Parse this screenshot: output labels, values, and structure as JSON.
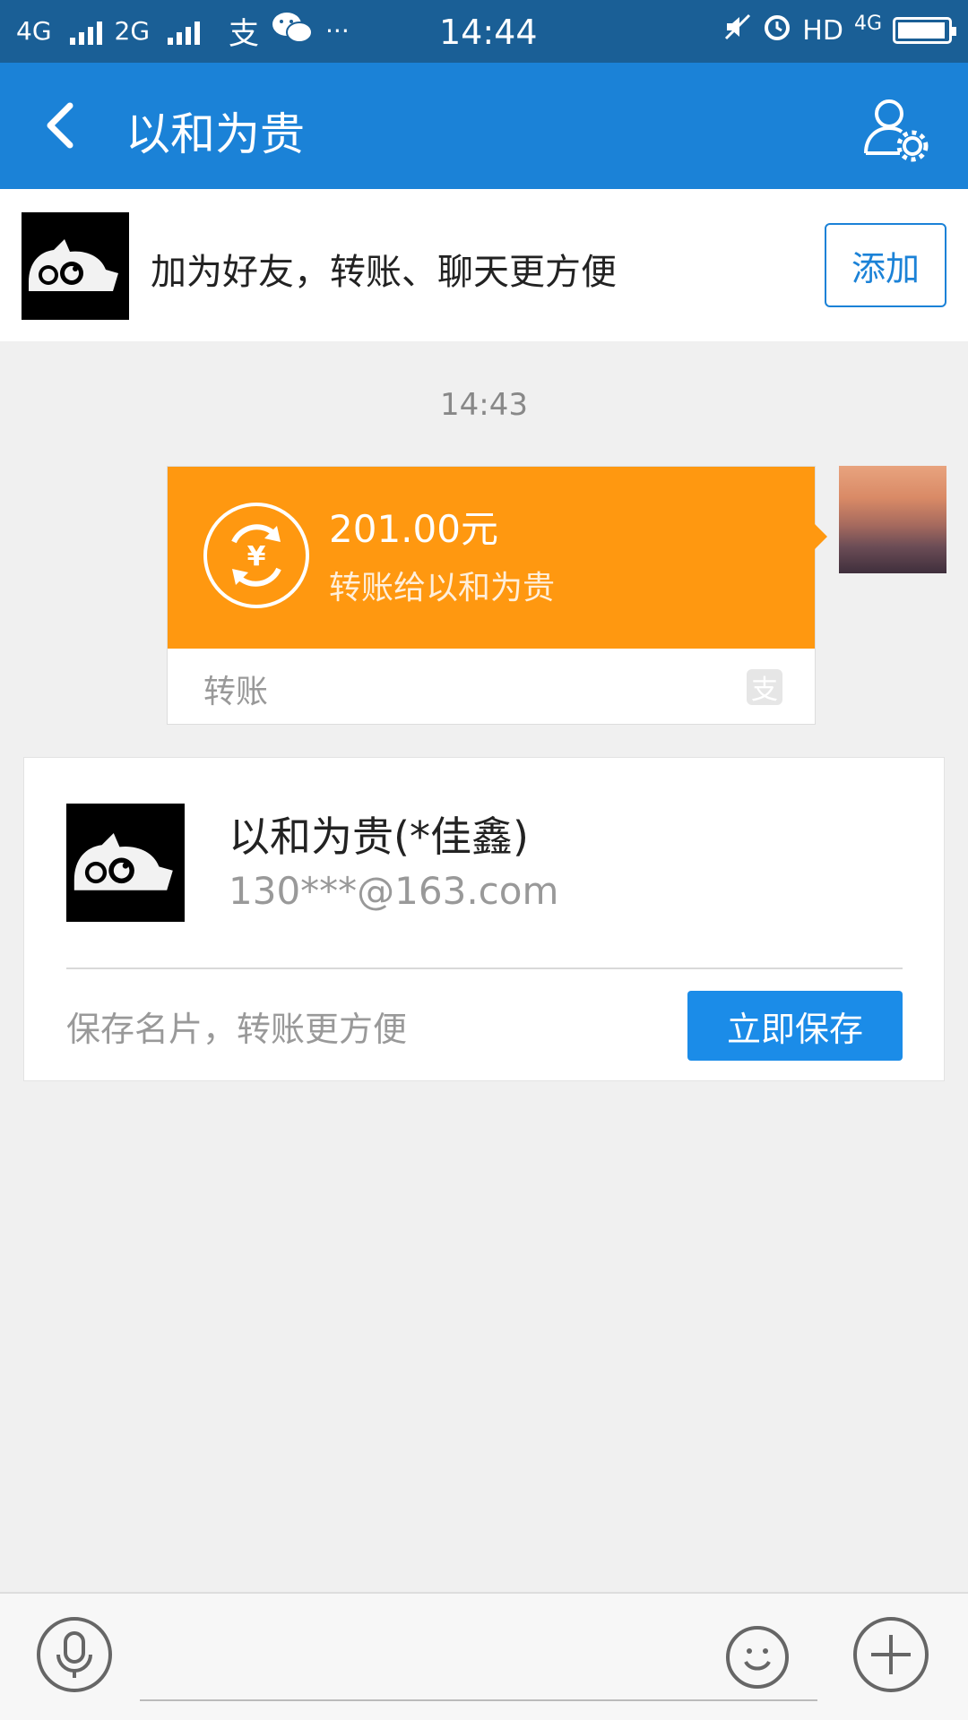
{
  "status_bar": {
    "net1": "4G",
    "net2": "2G",
    "alipay_glyph": "支",
    "dots": "···",
    "time": "14:44",
    "hd": "HD",
    "lte": "4G",
    "icons": [
      "signal-icon",
      "alipay-icon",
      "wechat-icon",
      "mute-icon",
      "alarm-icon",
      "battery-icon"
    ]
  },
  "header": {
    "title": "以和为贵",
    "back_icon": "back-arrow-icon",
    "profile_icon": "profile-settings-icon"
  },
  "add_friend": {
    "text": "加为好友，转账、聊天更方便",
    "button": "添加"
  },
  "chat": {
    "timestamp": "14:43",
    "transfer": {
      "amount": "201.00元",
      "description": "转账给以和为贵",
      "label": "转账",
      "logo": "支"
    }
  },
  "contact_card": {
    "name": "以和为贵(*佳鑫)",
    "email": "130***@163.com",
    "hint": "保存名片，转账更方便",
    "save_button": "立即保存"
  },
  "input_bar": {
    "icons": [
      "microphone-icon",
      "emoji-icon",
      "plus-icon"
    ]
  },
  "colors": {
    "status_bar": "#1a5f96",
    "nav_bar": "#1b82d7",
    "transfer_orange": "#ff9810",
    "save_button": "#1b8ce8"
  }
}
